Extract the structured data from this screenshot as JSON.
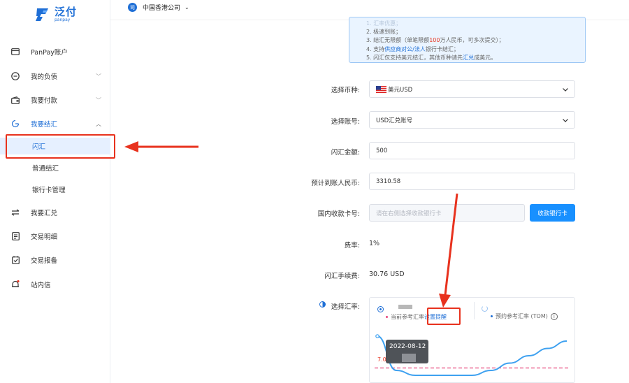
{
  "brand": {
    "name_cn": "泛付",
    "name_en": "panpay"
  },
  "header": {
    "company_avatar": "司",
    "company": "中国香港公司"
  },
  "sidebar": {
    "items": [
      {
        "label": "PanPay账户"
      },
      {
        "label": "我的负债"
      },
      {
        "label": "我要付款"
      },
      {
        "label": "我要结汇"
      },
      {
        "label": "我要汇兑"
      },
      {
        "label": "交易明细"
      },
      {
        "label": "交易报备"
      },
      {
        "label": "站内信"
      }
    ],
    "sub_items": [
      {
        "label": "闪汇"
      },
      {
        "label": "普通结汇"
      },
      {
        "label": "银行卡管理"
      }
    ]
  },
  "notice": {
    "line1": "1. 汇率优惠；",
    "line2": "2. 极速到账；",
    "line3_a": "3. 结汇无限额（单笔限额",
    "line3_hl": "100",
    "line3_b": "万人民币，可多次提交）；",
    "line4_a": "4. 支持",
    "line4_lk": "供应商对公/法人",
    "line4_b": "银行卡结汇；",
    "line5_a": "5. 闪汇仅支持美元结汇，其他币种请先",
    "line5_lk": "汇兑",
    "line5_b": "成美元。"
  },
  "form": {
    "currency_label": "选择币种:",
    "currency_value": "美元USD",
    "account_label": "选择账号:",
    "account_value": "USD汇兑账号",
    "amount_label": "闪汇金额:",
    "amount_value": "500",
    "rmb_label": "预计到账人民币:",
    "rmb_value": "3310.58",
    "card_label": "国内收款卡号:",
    "card_placeholder": "请在右侧选择收款银行卡",
    "card_button": "收款银行卡",
    "fee_rate_label": "费率:",
    "fee_rate_value": "1%",
    "fee_label": "闪汇手续费:",
    "fee_value": "30.76 USD",
    "rate_label": "选择汇率:"
  },
  "rate_panel": {
    "current_rate_label": "当前参考汇率",
    "set_alert": "设置提醒",
    "tom_rate_label": "预约参考汇率 (TOM)",
    "info_icon": "i",
    "tooltip_date": "2022-08-12",
    "ref_line_label": "7.0"
  },
  "colors": {
    "primary": "#1f6fd6",
    "button": "#1890ff",
    "annotation_red": "#e8321e",
    "line_blue": "#3ea1f0",
    "ref_pink": "#e8457c"
  },
  "chart_data": {
    "type": "line",
    "series": [
      {
        "values": [
          7.08,
          6.94,
          6.92,
          6.92,
          6.92,
          6.92,
          6.94,
          6.97,
          7.0,
          7.03,
          7.06
        ]
      }
    ],
    "reference_line": 6.95
  }
}
